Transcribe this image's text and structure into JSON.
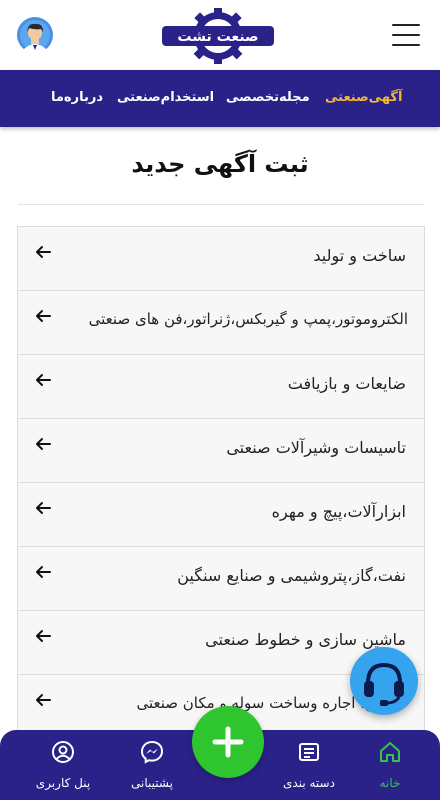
{
  "header": {
    "logo_text": "صنعت تشت"
  },
  "nav": {
    "items": [
      {
        "label": "آگهی‌صنعتی",
        "active": true
      },
      {
        "label": "مجله‌تخصصی",
        "active": false
      },
      {
        "label": "استخدام‌صنعتی",
        "active": false
      },
      {
        "label": "درباره‌ما",
        "active": false
      }
    ]
  },
  "page": {
    "title": "ثبت آگهی جدید"
  },
  "categories": [
    {
      "label": "ساخت و تولید"
    },
    {
      "label": "الکتروموتور،پمپ و گیربکس،ژنراتور،فن های صنعتی"
    },
    {
      "label": "ضایعات و بازیافت"
    },
    {
      "label": "تاسیسات وشیرآلات صنعتی"
    },
    {
      "label": "ابزارآلات،پیچ و مهره"
    },
    {
      "label": "نفت،گاز،پتروشیمی و صنایع سنگین"
    },
    {
      "label": "ماشین سازی و خطوط صنعتی"
    },
    {
      "label": "فروش، اجاره وساخت سوله و مکان صنعتی"
    }
  ],
  "bottom_nav": {
    "home": "خانه",
    "categories": "دسته بندی",
    "support": "پشتیبانی",
    "user_panel": "پنل کاربری"
  },
  "colors": {
    "brand": "#2a2189",
    "accent": "#f5b833",
    "active_green": "#33c64a",
    "fab_green": "#2fc52f",
    "support_blue": "#36a3ef"
  },
  "icons": [
    "avatar-icon",
    "menu-icon",
    "arrow-left-icon",
    "headset-icon",
    "plus-icon",
    "home-icon",
    "list-icon",
    "messenger-icon",
    "user-circle-icon"
  ]
}
